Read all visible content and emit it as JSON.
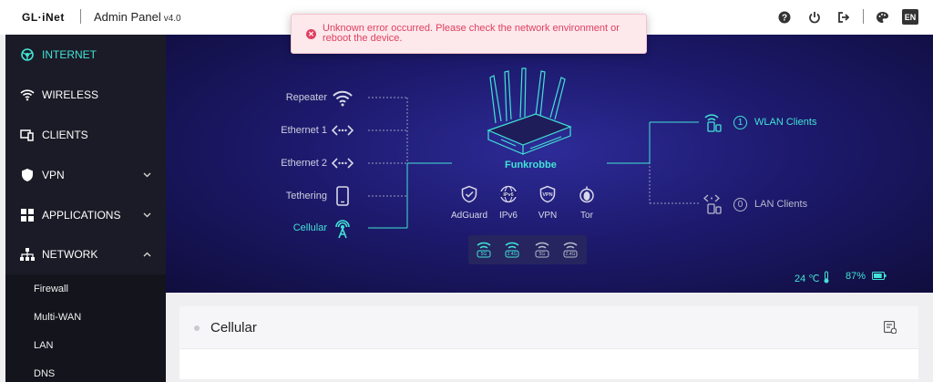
{
  "header": {
    "logo": "GL·iNet",
    "title": "Admin Panel",
    "version": "v4.0",
    "lang": "EN",
    "icons": [
      "help-icon",
      "power-icon",
      "logout-icon",
      "theme-icon"
    ]
  },
  "error_toast": {
    "message": "Unknown error occurred. Please check the network environment or reboot the device."
  },
  "sidebar": {
    "items": [
      {
        "label": "INTERNET",
        "icon": "internet-icon"
      },
      {
        "label": "WIRELESS",
        "icon": "wifi-icon"
      },
      {
        "label": "CLIENTS",
        "icon": "clients-icon"
      },
      {
        "label": "VPN",
        "icon": "shield-icon"
      },
      {
        "label": "APPLICATIONS",
        "icon": "apps-icon"
      },
      {
        "label": "NETWORK",
        "icon": "network-icon"
      }
    ],
    "sub_items": [
      "Firewall",
      "Multi-WAN",
      "LAN",
      "DNS"
    ]
  },
  "topology": {
    "sources": [
      {
        "label": "Repeater",
        "icon": "wifi-icon",
        "active": false
      },
      {
        "label": "Ethernet 1",
        "icon": "ethernet-icon",
        "active": false
      },
      {
        "label": "Ethernet 2",
        "icon": "ethernet-icon",
        "active": false
      },
      {
        "label": "Tethering",
        "icon": "phone-icon",
        "active": false
      },
      {
        "label": "Cellular",
        "icon": "cellular-icon",
        "active": true
      }
    ],
    "device_name": "Funkrobbe",
    "services": [
      "AdGuard",
      "IPv6",
      "VPN",
      "Tor"
    ],
    "wifi_bands": [
      "5G",
      "2.4G",
      "5G",
      "2.4G"
    ],
    "clients": [
      {
        "count": "1",
        "label": "WLAN Clients"
      },
      {
        "count": "0",
        "label": "LAN Clients"
      }
    ],
    "temperature": "24 ℃",
    "battery": "87%"
  },
  "main": {
    "card_title": "Cellular"
  },
  "colors": {
    "accent": "#42e3d6",
    "error": "#e0405f",
    "sidebar_bg": "#1b1b27"
  }
}
